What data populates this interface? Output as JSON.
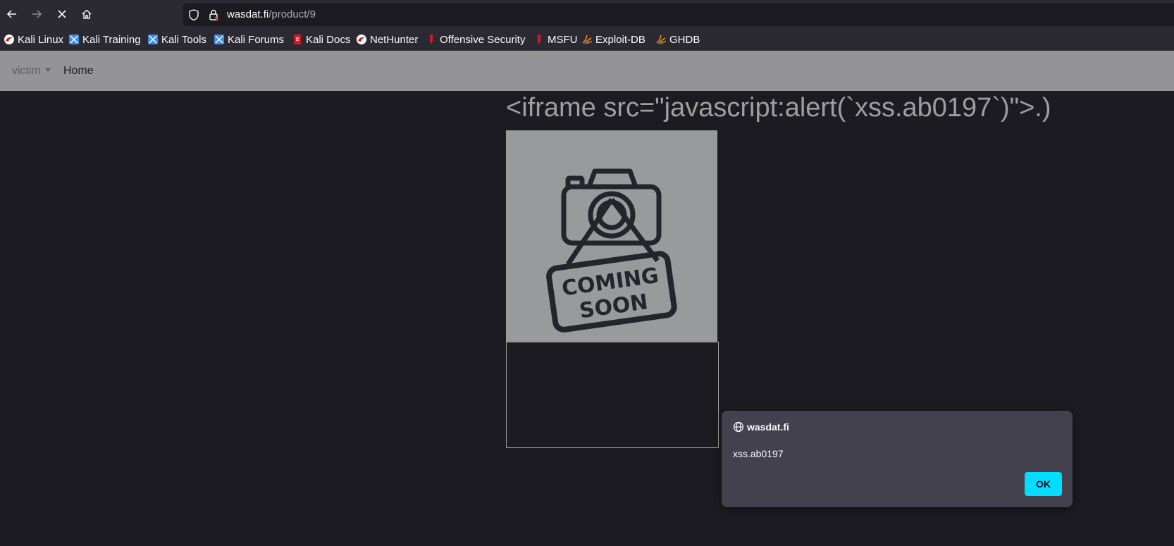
{
  "browser": {
    "url_host": "wasdat.fi",
    "url_path": "/product/9",
    "bookmarks": [
      {
        "label": "Kali Linux",
        "icon": "kali-dragon-icon"
      },
      {
        "label": "Kali Training",
        "icon": "kali-training-icon"
      },
      {
        "label": "Kali Tools",
        "icon": "kali-tools-icon"
      },
      {
        "label": "Kali Forums",
        "icon": "kali-forums-icon"
      },
      {
        "label": "Kali Docs",
        "icon": "kali-docs-icon"
      },
      {
        "label": "NetHunter",
        "icon": "nethunter-icon"
      },
      {
        "label": "Offensive Security",
        "icon": "offsec-icon"
      },
      {
        "label": "MSFU",
        "icon": "msfu-icon"
      },
      {
        "label": "Exploit-DB",
        "icon": "exploit-db-icon"
      },
      {
        "label": "GHDB",
        "icon": "ghdb-icon"
      }
    ]
  },
  "navbar": {
    "brand": "victim",
    "home": "Home"
  },
  "product": {
    "title": "<iframe src=\"javascript:alert(`xss.ab0197`)\">.)",
    "image_text_1": "COMING",
    "image_text_2": "SOON"
  },
  "dialog": {
    "origin": "wasdat.fi",
    "message": "xss.ab0197",
    "ok_label": "OK"
  },
  "colors": {
    "toolbar": "#2b2a33",
    "page_bg": "#1c1b22",
    "navbar": "#949496",
    "accent": "#00ddff"
  }
}
